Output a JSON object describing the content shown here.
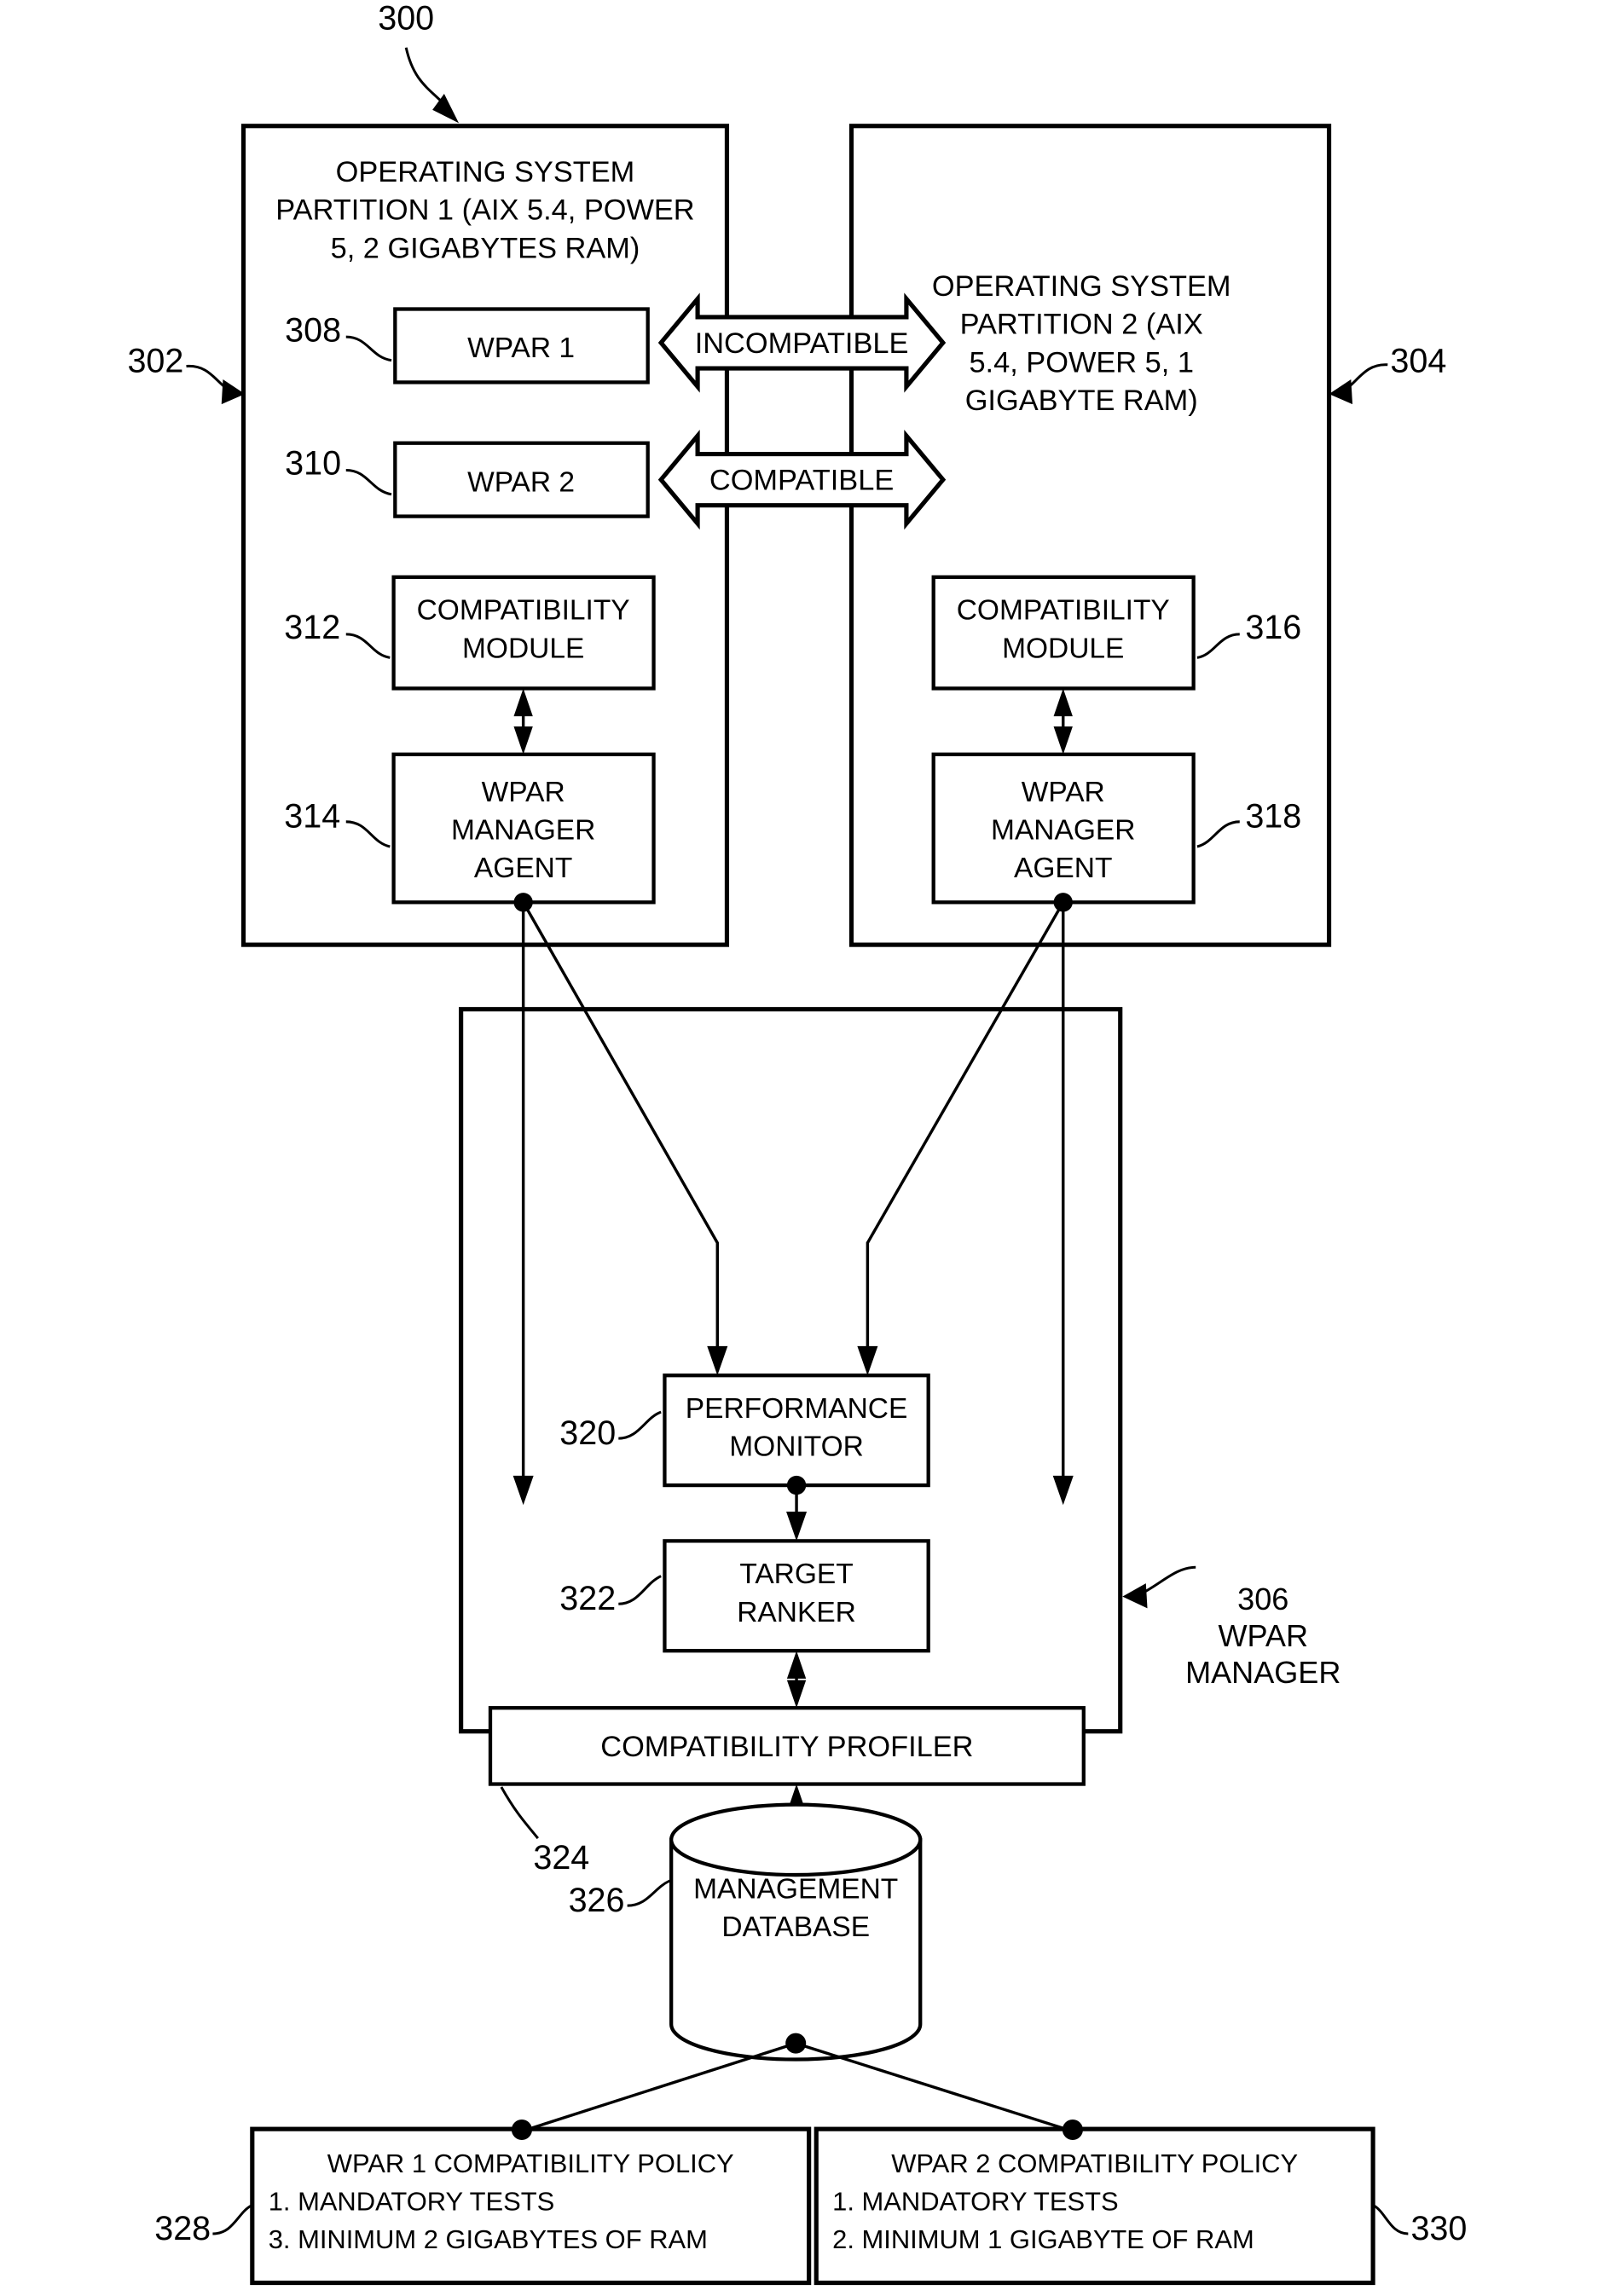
{
  "figure": {
    "figure_ref": "300"
  },
  "partitions": [
    {
      "ref": "302",
      "title_lines": [
        "OPERATING SYSTEM",
        "PARTITION 1 (AIX 5.4, POWER",
        "5, 2 GIGABYTES RAM)"
      ],
      "wpar": {
        "ref": "308",
        "label": "WPAR 1"
      },
      "compat_module": {
        "ref": "312",
        "label_lines": [
          "COMPATIBILITY",
          "MODULE"
        ]
      },
      "agent": {
        "ref": "314",
        "label_lines": [
          "WPAR",
          "MANAGER",
          "AGENT"
        ]
      }
    },
    {
      "ref": "304",
      "title_lines": [
        "OPERATING SYSTEM",
        "PARTITION 2 (AIX",
        "5.4, POWER 5, 1",
        "GIGABYTE RAM)"
      ],
      "wpar": {
        "ref": "310",
        "label": "WPAR 2"
      },
      "compat_module": {
        "ref": "316",
        "label_lines": [
          "COMPATIBILITY",
          "MODULE"
        ]
      },
      "agent": {
        "ref": "318",
        "label_lines": [
          "WPAR",
          "MANAGER",
          "AGENT"
        ]
      }
    }
  ],
  "relations": {
    "top_arrow_label": "INCOMPATIBLE",
    "bottom_arrow_label": "COMPATIBLE"
  },
  "manager": {
    "ref": "306",
    "label_lines": [
      "WPAR",
      "MANAGER"
    ],
    "components": [
      {
        "ref": "320",
        "label_lines": [
          "PERFORMANCE",
          "MONITOR"
        ]
      },
      {
        "ref": "322",
        "label_lines": [
          "TARGET",
          "RANKER"
        ]
      },
      {
        "ref": "324",
        "label_lines": [
          "COMPATIBILITY PROFILER"
        ]
      },
      {
        "ref": "326",
        "label_lines": [
          "MANAGEMENT",
          "DATABASE"
        ]
      }
    ]
  },
  "policies": [
    {
      "ref": "328",
      "title": "WPAR 1 COMPATIBILITY POLICY",
      "lines": [
        "1. MANDATORY TESTS",
        "3. MINIMUM 2 GIGABYTES OF RAM"
      ]
    },
    {
      "ref": "330",
      "title": "WPAR 2 COMPATIBILITY POLICY",
      "lines": [
        "1. MANDATORY TESTS",
        "2. MINIMUM 1 GIGABYTE OF RAM"
      ]
    }
  ],
  "colors": {
    "stroke": "#000000",
    "fill": "#ffffff"
  }
}
